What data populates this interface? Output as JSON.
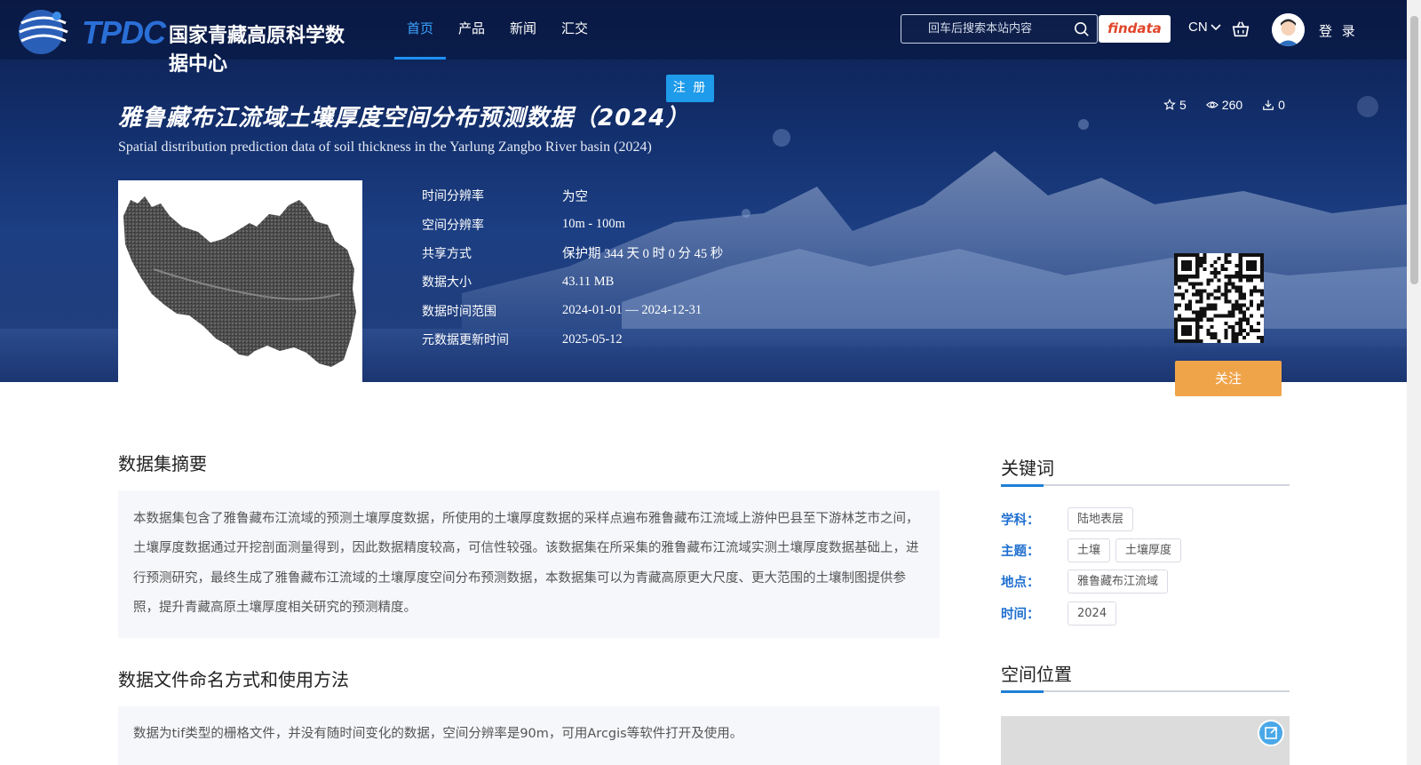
{
  "nav": {
    "logo_short": "TPDC",
    "logo_full": "国家青藏高原科学数据中心",
    "menu": [
      "首页",
      "产品",
      "新闻",
      "汇交"
    ],
    "search_placeholder": "回车后搜索本站内容",
    "findata": "findata",
    "lang": "CN",
    "login": "登 录",
    "register": "注 册"
  },
  "dataset": {
    "title_cn": "雅鲁藏布江流域土壤厚度空间分布预测数据（2024）",
    "title_en": "Spatial distribution prediction data of soil thickness in the Yarlung Zangbo River basin (2024)",
    "stats": {
      "stars": "5",
      "views": "260",
      "downloads": "0"
    },
    "meta": [
      {
        "key": "时间分辨率",
        "value": "为空"
      },
      {
        "key": "空间分辨率",
        "value": "10m - 100m"
      },
      {
        "key": "共享方式",
        "value": "保护期 344 天 0 时 0 分 45 秒"
      },
      {
        "key": "数据大小",
        "value": "43.11 MB"
      },
      {
        "key": "数据时间范围",
        "value": "2024-01-01 — 2024-12-31"
      },
      {
        "key": "元数据更新时间",
        "value": "2025-05-12"
      }
    ],
    "follow": "关注"
  },
  "content": {
    "abstract_title": "数据集摘要",
    "abstract_text": "本数据集包含了雅鲁藏布江流域的预测土壤厚度数据，所使用的土壤厚度数据的采样点遍布雅鲁藏布江流域上游仲巴县至下游林芝市之间，土壤厚度数据通过开挖剖面测量得到，因此数据精度较高，可信性较强。该数据集在所采集的雅鲁藏布江流域实测土壤厚度数据基础上，进行预测研究，最终生成了雅鲁藏布江流域的土壤厚度空间分布预测数据，本数据集可以为青藏高原更大尺度、更大范围的土壤制图提供参照，提升青藏高原土壤厚度相关研究的预测精度。",
    "naming_title": "数据文件命名方式和使用方法",
    "naming_text": "数据为tif类型的栅格文件，并没有随时间变化的数据，空间分辨率是90m，可用Arcgis等软件打开及使用。"
  },
  "sidebar": {
    "keywords_title": "关键词",
    "keywords": [
      {
        "label": "学科：",
        "tags": [
          "陆地表层"
        ]
      },
      {
        "label": "主题：",
        "tags": [
          "土壤",
          "土壤厚度"
        ]
      },
      {
        "label": "地点：",
        "tags": [
          "雅鲁藏布江流域"
        ]
      },
      {
        "label": "时间：",
        "tags": [
          "2024"
        ]
      }
    ],
    "location_title": "空间位置"
  }
}
